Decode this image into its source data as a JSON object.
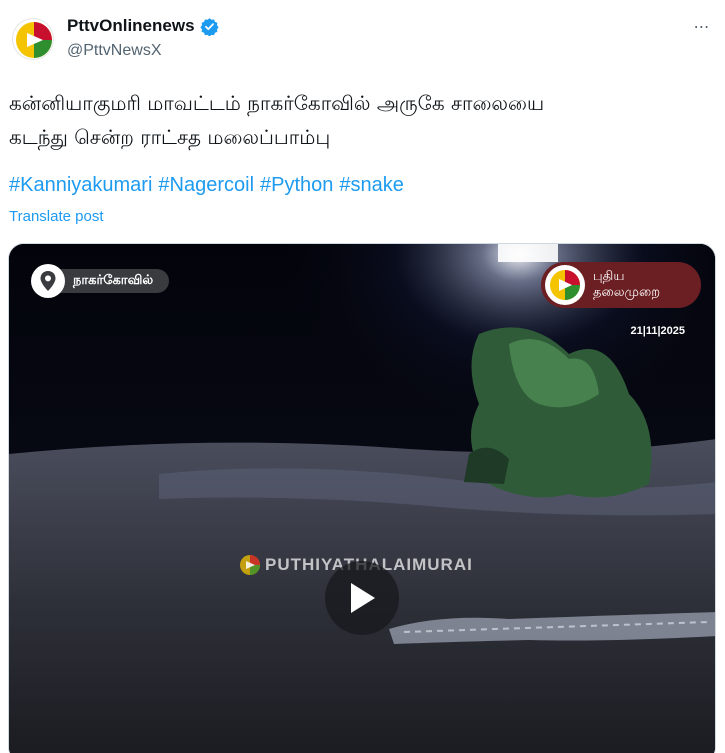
{
  "author": {
    "display_name": "PttvOnlinenews",
    "handle": "@PttvNewsX",
    "verified": true,
    "more_icon": "⋯"
  },
  "post": {
    "text_line1": "கன்னியாகுமரி மாவட்டம் நாகர்கோவில் அருகே சாலையை",
    "text_line2": "கடந்து சென்ற ராட்சத மலைப்பாம்பு",
    "hashtags": [
      "#Kanniyakumari",
      "#Nagercoil",
      "#Python",
      "#snake"
    ],
    "translate_label": "Translate post"
  },
  "media": {
    "location_label": "நாகர்கோவில்",
    "channel_name_line1": "புதிய",
    "channel_name_line2": "தலைமுறை",
    "date": "21|11|2025",
    "watermark": "PUTHIYATHALAIMURAI",
    "play_icon": "play-icon"
  },
  "colors": {
    "accent": "#1d9bf0",
    "verified": "#1d9bf0",
    "logo_red": "#c8102e",
    "logo_green": "#2f8f2f",
    "logo_yellow": "#f4c400"
  }
}
